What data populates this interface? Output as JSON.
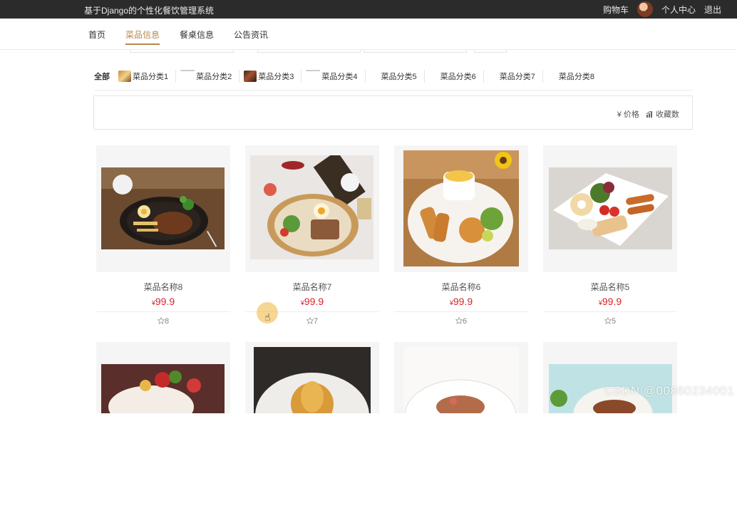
{
  "topbar": {
    "title": "基于Django的个性化餐饮管理系统",
    "cart": "购物车",
    "profile": "个人中心",
    "logout": "退出"
  },
  "nav": {
    "items": [
      "首页",
      "菜品信息",
      "餐桌信息",
      "公告资讯"
    ],
    "active": "菜品信息"
  },
  "categories": {
    "all": "全部",
    "items": [
      "菜品分类1",
      "菜品分类2",
      "菜品分类3",
      "菜品分类4",
      "菜品分类5",
      "菜品分类6",
      "菜品分类7",
      "菜品分类8"
    ]
  },
  "sort": {
    "price": "¥ 价格",
    "favorites": "收藏数"
  },
  "products": [
    {
      "name": "菜品名称8",
      "currency": "¥",
      "price": "99.9",
      "favorites": "8"
    },
    {
      "name": "菜品名称7",
      "currency": "¥",
      "price": "99.9",
      "favorites": "7"
    },
    {
      "name": "菜品名称6",
      "currency": "¥",
      "price": "99.9",
      "favorites": "6"
    },
    {
      "name": "菜品名称5",
      "currency": "¥",
      "price": "99.9",
      "favorites": "5"
    }
  ],
  "watermark": "CSDN @00860234001",
  "colors": {
    "accent": "#b58a4f",
    "price": "#d8232a",
    "topbar": "#2b2b2b"
  },
  "icons": {
    "star": "star-icon",
    "chart": "chart-icon",
    "yen": "yen-icon"
  }
}
